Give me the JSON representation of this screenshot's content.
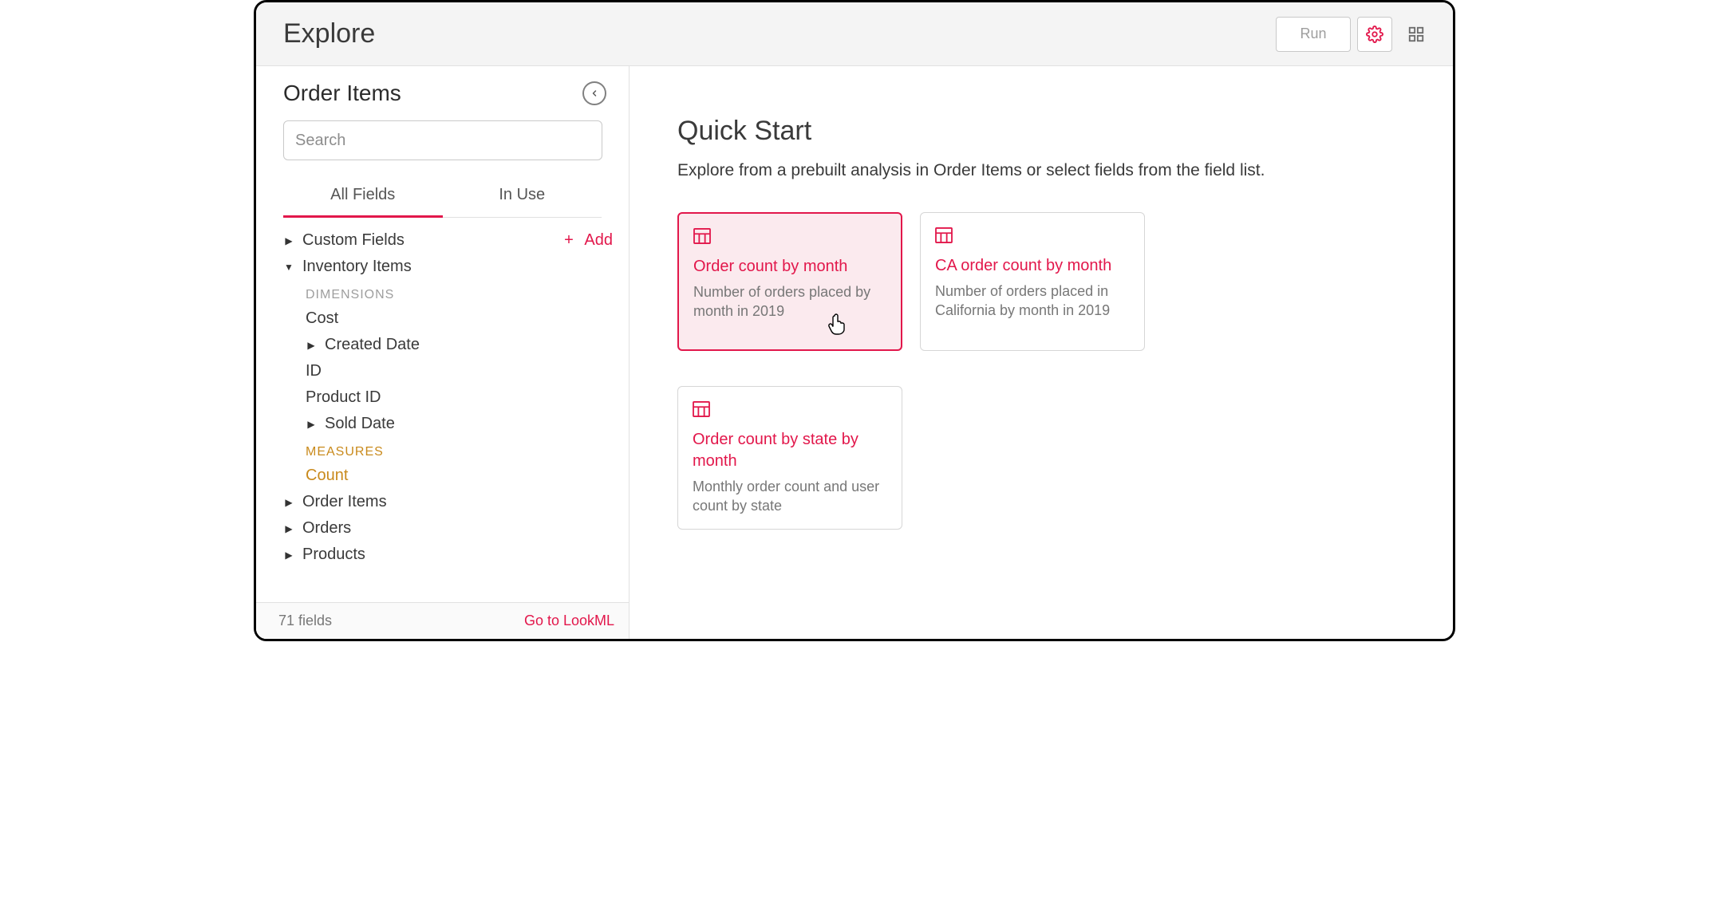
{
  "header": {
    "title": "Explore",
    "run_label": "Run"
  },
  "sidebar": {
    "explore_name": "Order Items",
    "search_placeholder": "Search",
    "tabs": {
      "all_fields": "All Fields",
      "in_use": "In Use"
    },
    "add_label": "Add",
    "groups": {
      "custom_fields": "Custom Fields",
      "inventory_items": "Inventory Items",
      "dimensions_label": "DIMENSIONS",
      "measures_label": "MEASURES",
      "cost": "Cost",
      "created_date": "Created Date",
      "id": "ID",
      "product_id": "Product ID",
      "sold_date": "Sold Date",
      "count": "Count",
      "order_items": "Order Items",
      "orders": "Orders",
      "products": "Products"
    },
    "footer": {
      "fields_count": "71 fields",
      "go_to_lookml": "Go to LookML"
    }
  },
  "main": {
    "quick_start_title": "Quick Start",
    "quick_start_sub": "Explore from a prebuilt analysis in Order Items or select fields from the field list.",
    "cards": [
      {
        "title": "Order count by month",
        "desc": "Number of orders placed by month in 2019"
      },
      {
        "title": "CA order count by month",
        "desc": "Number of orders placed in California by month in 2019"
      },
      {
        "title": "Order count by state by month",
        "desc": "Monthly order count and user count by state"
      }
    ]
  }
}
